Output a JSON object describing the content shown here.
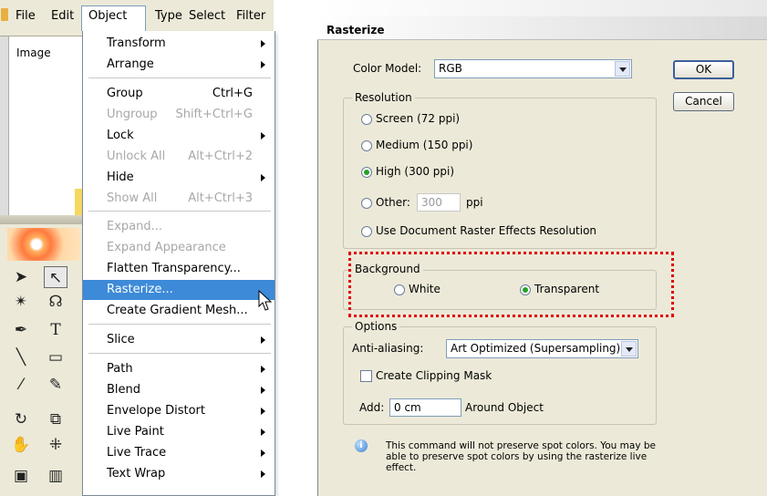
{
  "menubar": {
    "items": [
      "File",
      "Edit",
      "Object",
      "Type",
      "Select",
      "Filter"
    ]
  },
  "side_label": "Image",
  "object_menu": {
    "items": [
      {
        "label": "Transform",
        "shortcut": "",
        "submenu": true,
        "disabled": false
      },
      {
        "label": "Arrange",
        "shortcut": "",
        "submenu": true,
        "disabled": false
      },
      {
        "label": "Group",
        "shortcut": "Ctrl+G",
        "submenu": false,
        "disabled": false
      },
      {
        "label": "Ungroup",
        "shortcut": "Shift+Ctrl+G",
        "submenu": false,
        "disabled": true
      },
      {
        "label": "Lock",
        "shortcut": "",
        "submenu": true,
        "disabled": false
      },
      {
        "label": "Unlock All",
        "shortcut": "Alt+Ctrl+2",
        "submenu": false,
        "disabled": true
      },
      {
        "label": "Hide",
        "shortcut": "",
        "submenu": true,
        "disabled": false
      },
      {
        "label": "Show All",
        "shortcut": "Alt+Ctrl+3",
        "submenu": false,
        "disabled": true
      },
      {
        "label": "Expand...",
        "shortcut": "",
        "submenu": false,
        "disabled": true
      },
      {
        "label": "Expand Appearance",
        "shortcut": "",
        "submenu": false,
        "disabled": true
      },
      {
        "label": "Flatten Transparency...",
        "shortcut": "",
        "submenu": false,
        "disabled": false
      },
      {
        "label": "Rasterize...",
        "shortcut": "",
        "submenu": false,
        "disabled": false,
        "highlighted": true
      },
      {
        "label": "Create Gradient Mesh...",
        "shortcut": "",
        "submenu": false,
        "disabled": false
      },
      {
        "label": "Slice",
        "shortcut": "",
        "submenu": true,
        "disabled": false
      },
      {
        "label": "Path",
        "shortcut": "",
        "submenu": true,
        "disabled": false
      },
      {
        "label": "Blend",
        "shortcut": "",
        "submenu": true,
        "disabled": false
      },
      {
        "label": "Envelope Distort",
        "shortcut": "",
        "submenu": true,
        "disabled": false
      },
      {
        "label": "Live Paint",
        "shortcut": "",
        "submenu": true,
        "disabled": false
      },
      {
        "label": "Live Trace",
        "shortcut": "",
        "submenu": true,
        "disabled": false
      },
      {
        "label": "Text Wrap",
        "shortcut": "",
        "submenu": true,
        "disabled": false
      }
    ]
  },
  "dialog": {
    "title": "Rasterize",
    "color_model_label": "Color Model:",
    "color_model_value": "RGB",
    "ok_label": "OK",
    "cancel_label": "Cancel",
    "resolution": {
      "title": "Resolution",
      "options": [
        "Screen (72 ppi)",
        "Medium (150 ppi)",
        "High (300 ppi)",
        "Other:",
        "Use Document Raster Effects Resolution"
      ],
      "selected": "High (300 ppi)",
      "other_value": "300",
      "other_unit": "ppi"
    },
    "background": {
      "title": "Background",
      "white_label": "White",
      "transparent_label": "Transparent",
      "selected": "Transparent"
    },
    "options": {
      "title": "Options",
      "antialias_label": "Anti-aliasing:",
      "antialias_value": "Art Optimized (Supersampling)",
      "clipping_label": "Create Clipping Mask",
      "add_label": "Add:",
      "add_value": "0 cm",
      "around_label": "Around Object"
    },
    "note": "This command will not preserve spot colors. You may be able to preserve spot colors by using the rasterize live effect.",
    "accent_highlight": "#3d8ad9",
    "callout_color": "#e00000"
  }
}
